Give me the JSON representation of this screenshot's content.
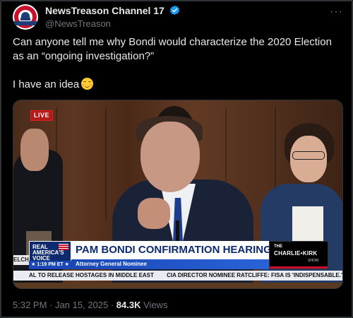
{
  "author": {
    "display_name": "NewsTreason Channel 17",
    "handle": "@NewsTreason",
    "verified": true,
    "avatar_icon": "news-treason-logo-icon"
  },
  "more_icon": "more-options-icon",
  "tweet": {
    "text_line1": "Can anyone tell me why Bondi would characterize the 2020 Election as an “ongoing investigation?”",
    "text_line2": "I have an idea",
    "emoji": "smiling-face-icon"
  },
  "video": {
    "live_badge": "LIVE",
    "logo_line1": "REAL",
    "logo_line2": "AMERICA'S",
    "logo_line3": "VOICE",
    "time": "1:19 PM ET",
    "left_cutoff": "ELCH",
    "headline": "PAM BONDI CONFIRMATION HEARING",
    "subheadline": "Attorney General Nominee",
    "show_the": "THE",
    "show_name": "CHARLIE•KIRK",
    "show_label": "SHOW",
    "ticker_1": "AL TO RELEASE HOSTAGES IN MIDDLE EAST",
    "ticker_2": "CIA DIRECTOR NOMINEE RATCLIFFE: FISA IS 'INDISPENSABLE.'"
  },
  "meta": {
    "time": "5:32 PM",
    "separator": "·",
    "date": "Jan 15, 2025",
    "views_count": "84.3K",
    "views_label": "Views"
  },
  "colors": {
    "background": "#000000",
    "text_primary": "#e7e9ea",
    "text_secondary": "#71767b",
    "verified_blue": "#1d9bf0",
    "brand_navy": "#0d2a6e",
    "live_red": "#b31b1b"
  }
}
